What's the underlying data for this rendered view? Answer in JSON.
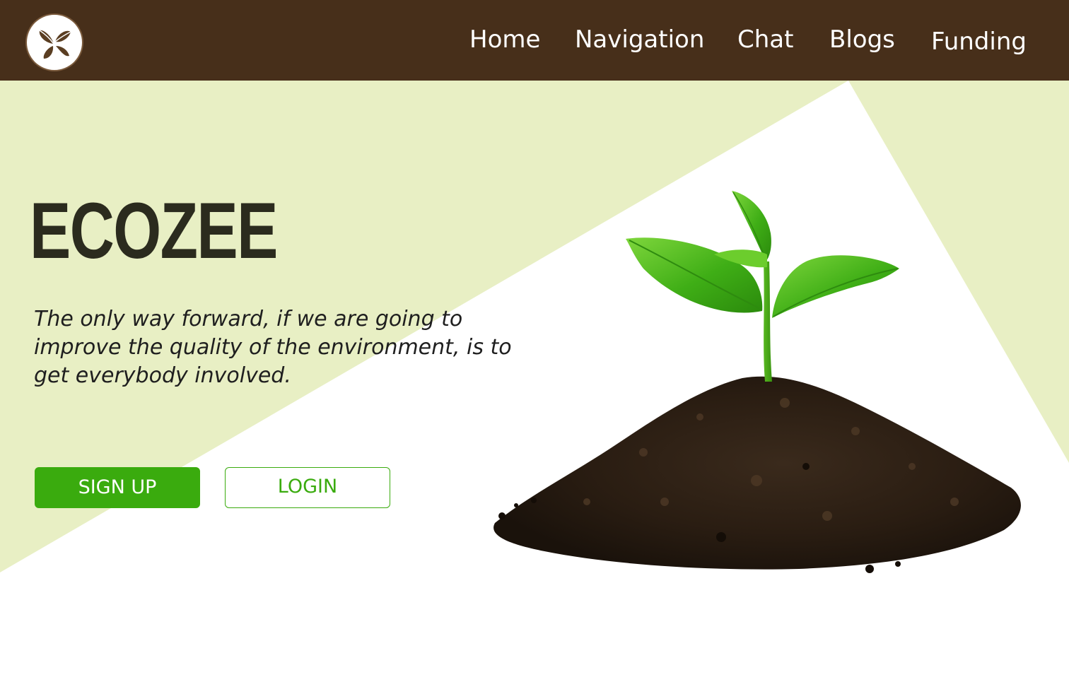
{
  "brand": {
    "logo_icon": "leaf-sprout-icon",
    "colors": {
      "header": "#472f1a",
      "hero_background": "#e8efc4",
      "accent_green": "#3aab0e",
      "title": "#2b2b1e"
    }
  },
  "nav": {
    "items": [
      "Home",
      "Navigation",
      "Chat",
      "Blogs",
      "Funding"
    ]
  },
  "hero": {
    "title": "ECOZEE",
    "tagline": "The only way forward, if we are going to improve the quality of the environment, is to get everybody involved.",
    "signup_label": "SIGN UP",
    "login_label": "LOGIN",
    "image_subject": "seedling-in-soil"
  }
}
